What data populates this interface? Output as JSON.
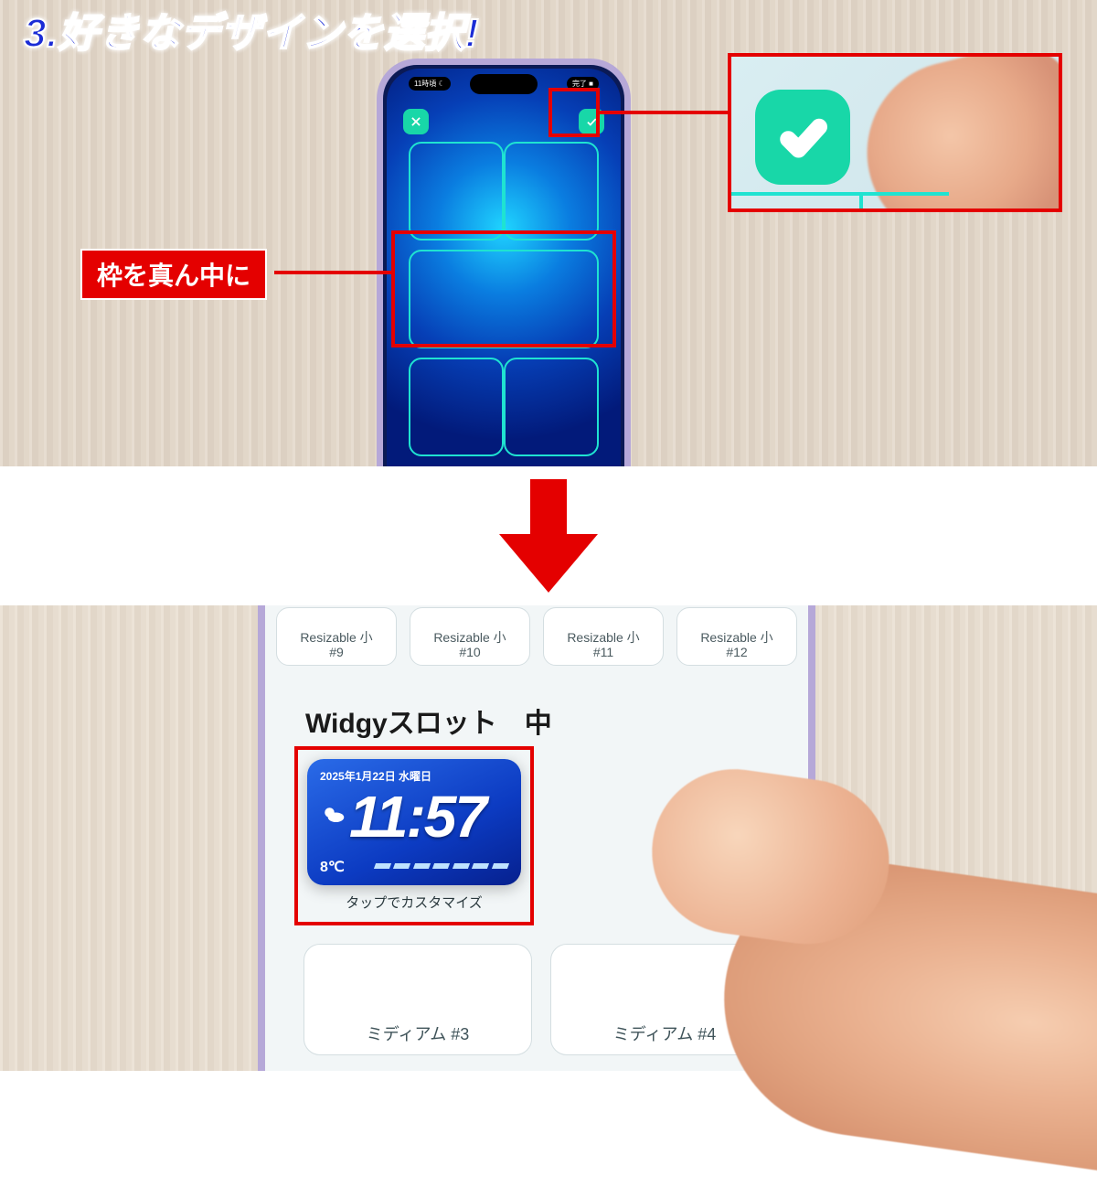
{
  "step_title": "3.好きなデザインを選択!",
  "callouts": {
    "center_frame": "枠を真ん中に"
  },
  "phone_top": {
    "status_left": "11時頃 ☾",
    "status_right": "完了 ■",
    "close_button": "×",
    "confirm_button": "✓"
  },
  "magnifier": {
    "confirm_button": "✓"
  },
  "phone_bottom": {
    "small_slots": [
      {
        "line1": "Resizable 小",
        "line2": "#9"
      },
      {
        "line1": "Resizable 小",
        "line2": "#10"
      },
      {
        "line1": "Resizable 小",
        "line2": "#11"
      },
      {
        "line1": "Resizable 小",
        "line2": "#12"
      }
    ],
    "section_heading": "Widgyスロット　中",
    "widget_preview": {
      "date": "2025年1月22日 水曜日",
      "time": "11:57",
      "temp": "8℃",
      "tap_label": "タップでカスタマイズ"
    },
    "medium_slots": {
      "m3": "ミディアム #3",
      "m4": "ミディアム #4"
    }
  }
}
